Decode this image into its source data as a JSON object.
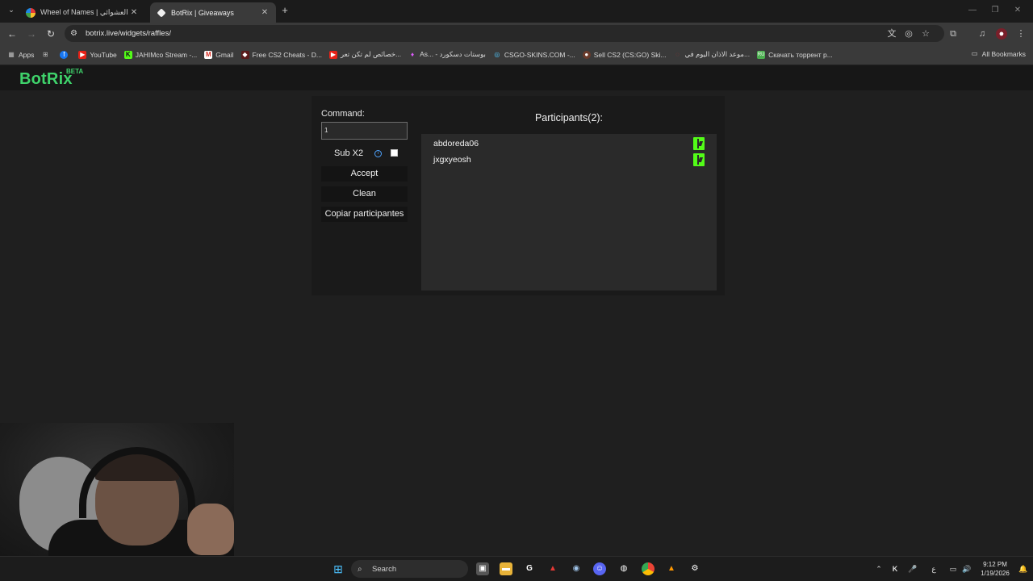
{
  "browser": {
    "tabs": [
      {
        "title": "Wheel of Names | اسم العشوائي",
        "active": false
      },
      {
        "title": "BotRix | Giveaways",
        "active": true
      }
    ],
    "url": "botrix.live/widgets/raffles/",
    "bookmarks": [
      {
        "label": "Apps",
        "icon": "apps-grid-icon"
      },
      {
        "label": "",
        "icon": "google-apps-icon"
      },
      {
        "label": "",
        "icon": "facebook-icon"
      },
      {
        "label": "YouTube",
        "icon": "youtube-icon"
      },
      {
        "label": "JAHIMco Stream -...",
        "icon": "kick-icon"
      },
      {
        "label": "Gmail",
        "icon": "gmail-icon"
      },
      {
        "label": "Free CS2 Cheats - D...",
        "icon": "cheats-icon"
      },
      {
        "label": "خصائص لم تكن تعر...",
        "icon": "youtube-icon"
      },
      {
        "label": "As... - بوستات دسكورد",
        "icon": "gem-icon"
      },
      {
        "label": "CSGO-SKINS.COM -...",
        "icon": "csgo-icon"
      },
      {
        "label": "Sell CS2 (CS:GO) Ski...",
        "icon": "skins-icon"
      },
      {
        "label": "موعد الاذان اليوم في...",
        "icon": "mosque-icon"
      },
      {
        "label": "Скачать торрент р...",
        "icon": "torrent-icon"
      }
    ],
    "all_bookmarks": "All Bookmarks"
  },
  "site": {
    "logo": "BotRix",
    "badge": "BETA"
  },
  "raffle": {
    "command_label": "Command:",
    "command_value": "1",
    "sub_label": "Sub X2",
    "accept": "Accept",
    "clean": "Clean",
    "copy": "Copiar participantes",
    "participants_title": "Participants(2):",
    "participants": [
      {
        "name": "abdoreda06",
        "platform": "kick"
      },
      {
        "name": "jxgxyeosh",
        "platform": "kick"
      }
    ]
  },
  "taskbar": {
    "search": "Search",
    "time": "9:12 PM",
    "date": "1/19/2026",
    "lang": "ع"
  },
  "colors": {
    "brand_green": "#3fd36b",
    "kick_green": "#53fc18",
    "info_blue": "#4ea3ff"
  }
}
